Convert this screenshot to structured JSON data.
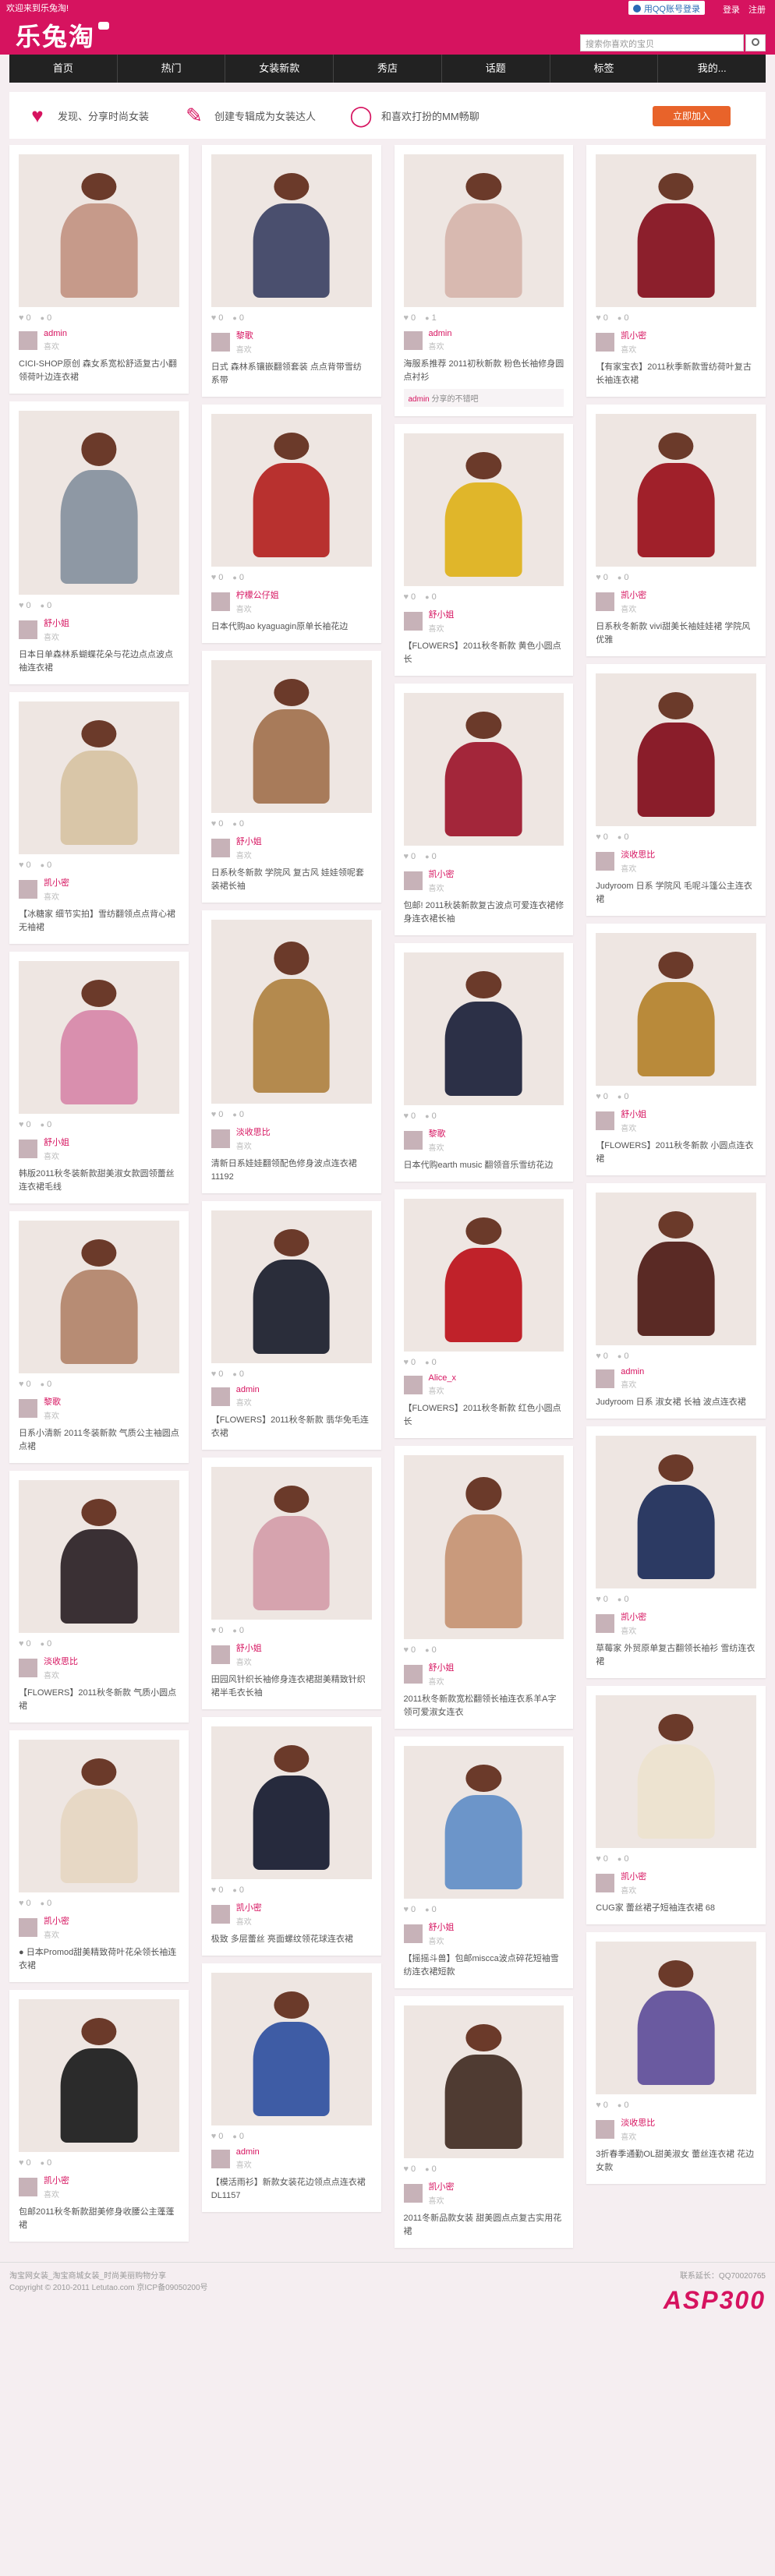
{
  "header": {
    "welcome": "欢迎来到乐兔淘!",
    "logo": "乐兔淘",
    "qq_login": "用QQ账号登录",
    "login": "登录",
    "register": "注册",
    "search_placeholder": "搜索你喜欢的宝贝"
  },
  "nav": [
    "首页",
    "热门",
    "女装新款",
    "秀店",
    "话题",
    "标签",
    "我的..."
  ],
  "promo": {
    "items": [
      {
        "icon": "heart-icon",
        "text": "发现、分享时尚女装"
      },
      {
        "icon": "pencil-icon",
        "text": "创建专辑成为女装达人"
      },
      {
        "icon": "chat-icon",
        "text": "和喜欢打扮的MM畅聊"
      }
    ],
    "join": "立即加入"
  },
  "columns": [
    [
      {
        "likes": "0",
        "comments": "0",
        "author": "admin",
        "sub": "喜欢",
        "desc": "CICI-SHOP原创 森女系宽松舒适复古小翻领荷叶边连衣裙",
        "color": "#c69a8a"
      },
      {
        "likes": "0",
        "comments": "0",
        "author": "舒小姐",
        "sub": "喜欢",
        "desc": "日本日单森林系蝴蝶花朵与花边点点波点袖连衣裙",
        "color": "#8e98a4"
      },
      {
        "likes": "0",
        "comments": "0",
        "author": "凯小密",
        "sub": "喜欢",
        "desc": "【冰糖家 细节实拍】雪纺翻领点点背心裙 无袖裙",
        "color": "#d9c6a8"
      },
      {
        "likes": "0",
        "comments": "0",
        "author": "舒小姐",
        "sub": "喜欢",
        "desc": "韩版2011秋冬装新款甜美淑女款圆领蕾丝连衣裙毛线",
        "color": "#d98fae"
      },
      {
        "likes": "0",
        "comments": "0",
        "author": "黎歌",
        "sub": "喜欢",
        "desc": "日系小清新 2011冬装新款 气质公主袖圆点点裙",
        "color": "#b78c74"
      },
      {
        "likes": "0",
        "comments": "0",
        "author": "淡收思比",
        "sub": "喜欢",
        "desc": "【FLOWERS】2011秋冬新款 气质小圆点裙",
        "color": "#3a3034"
      },
      {
        "likes": "0",
        "comments": "0",
        "author": "凯小密",
        "sub": "喜欢",
        "desc": "● 日本Promod甜美精致荷叶花朵领长袖连衣裙",
        "color": "#e7d8c5"
      },
      {
        "likes": "0",
        "comments": "0",
        "author": "凯小密",
        "sub": "喜欢",
        "desc": "包邮2011秋冬新款甜美修身收腰公主蓬蓬裙",
        "color": "#2b2b2b"
      }
    ],
    [
      {
        "likes": "0",
        "comments": "0",
        "author": "黎歌",
        "sub": "喜欢",
        "desc": "日式 森林系镶嵌翻领套装 点点背带雪纺 系带",
        "color": "#4a4f6e"
      },
      {
        "likes": "0",
        "comments": "0",
        "author": "柠檬公仔姐",
        "sub": "喜欢",
        "desc": "日本代购ao kyaguagin原单长袖花边",
        "color": "#b8312f"
      },
      {
        "likes": "0",
        "comments": "0",
        "author": "舒小姐",
        "sub": "喜欢",
        "desc": "日系秋冬新款 学院风 复古风 娃娃领呢套装裙长袖",
        "color": "#a87b5a"
      },
      {
        "likes": "0",
        "comments": "0",
        "author": "淡收思比",
        "sub": "喜欢",
        "desc": "清新日系娃娃翻领配色修身波点连衣裙11192",
        "color": "#b48a4e"
      },
      {
        "likes": "0",
        "comments": "0",
        "author": "admin",
        "sub": "喜欢",
        "desc": "【FLOWERS】2011秋冬新款 翡华免毛连衣裙",
        "color": "#2a2d3a"
      },
      {
        "likes": "0",
        "comments": "0",
        "author": "舒小姐",
        "sub": "喜欢",
        "desc": "田园风针织长袖修身连衣裙甜美精致针织裙半毛衣长袖",
        "color": "#d6a3ae"
      },
      {
        "likes": "0",
        "comments": "0",
        "author": "凯小密",
        "sub": "喜欢",
        "desc": "极致 多层蕾丝 亮面螺纹领花球连衣裙",
        "color": "#262a3d"
      },
      {
        "likes": "0",
        "comments": "0",
        "author": "admin",
        "sub": "喜欢",
        "desc": "【模活雨衫】新款女装花边领点点连衣裙DL1157",
        "color": "#3e5ca5"
      }
    ],
    [
      {
        "likes": "0",
        "comments": "1",
        "author": "admin",
        "sub": "喜欢",
        "desc": "海服系推荐 2011初秋新款 粉色长袖修身圆点衬衫",
        "comment_user": "admin",
        "comment": "分享的不错吧",
        "color": "#d8b9b0"
      },
      {
        "likes": "0",
        "comments": "0",
        "author": "舒小姐",
        "sub": "喜欢",
        "desc": "【FLOWERS】2011秋冬新款 黄色小圆点长",
        "color": "#e0b62a"
      },
      {
        "likes": "0",
        "comments": "0",
        "author": "凯小密",
        "sub": "喜欢",
        "desc": "包邮! 2011秋装新款复古波点可爱连衣裙修身连衣裙长袖",
        "color": "#a3263a"
      },
      {
        "likes": "0",
        "comments": "0",
        "author": "黎歌",
        "sub": "喜欢",
        "desc": "日本代购earth music 翻领音乐雪纺花边",
        "color": "#2c3047"
      },
      {
        "likes": "0",
        "comments": "0",
        "author": "Alice_x",
        "sub": "喜欢",
        "desc": "【FLOWERS】2011秋冬新款 红色小圆点长",
        "color": "#c0222a"
      },
      {
        "likes": "0",
        "comments": "0",
        "author": "舒小姐",
        "sub": "喜欢",
        "desc": "2011秋冬新款宽松翻领长袖连衣系羊A字领可爱淑女连衣",
        "color": "#c99a7c"
      },
      {
        "likes": "0",
        "comments": "0",
        "author": "舒小姐",
        "sub": "喜欢",
        "desc": "【摇摇斗兽】包邮miscca波点碎花短袖雪纺连衣裙短款",
        "color": "#6c95c9"
      },
      {
        "likes": "0",
        "comments": "0",
        "author": "凯小密",
        "sub": "喜欢",
        "desc": "2011冬新品款女装 甜美圆点点复古实用花裙",
        "color": "#4f3b32"
      }
    ],
    [
      {
        "likes": "0",
        "comments": "0",
        "author": "凯小密",
        "sub": "喜欢",
        "desc": "【有家宝衣】2011秋季新款雪纺荷叶复古长袖连衣裙",
        "color": "#8c1f2c"
      },
      {
        "likes": "0",
        "comments": "0",
        "author": "凯小密",
        "sub": "喜欢",
        "desc": "日系秋冬新款 vivi甜美长袖娃娃裙 学院风 优雅",
        "color": "#a0202a"
      },
      {
        "likes": "0",
        "comments": "0",
        "author": "淡收思比",
        "sub": "喜欢",
        "desc": "Judyroom 日系 学院风 毛呢斗篷公主连衣裙",
        "color": "#8a1d2a"
      },
      {
        "likes": "0",
        "comments": "0",
        "author": "舒小姐",
        "sub": "喜欢",
        "desc": "【FLOWERS】2011秋冬新款 小圆点连衣裙",
        "color": "#b98a3a"
      },
      {
        "likes": "0",
        "comments": "0",
        "author": "admin",
        "sub": "喜欢",
        "desc": "Judyroom 日系 淑女裙 长袖 波点连衣裙",
        "color": "#5a2a25"
      },
      {
        "likes": "0",
        "comments": "0",
        "author": "凯小密",
        "sub": "喜欢",
        "desc": "草莓家 外贸原单复古翻领长袖衫 雪纺连衣裙",
        "color": "#2c3a63"
      },
      {
        "likes": "0",
        "comments": "0",
        "author": "凯小密",
        "sub": "喜欢",
        "desc": "CUG家 蕾丝裙子短袖连衣裙 68",
        "color": "#ede3d0"
      },
      {
        "likes": "0",
        "comments": "0",
        "author": "淡收思比",
        "sub": "喜欢",
        "desc": "3折春季通勤OL甜美淑女 蕾丝连衣裙 花边女款",
        "color": "#6a5aa0"
      }
    ]
  ],
  "footer": {
    "line1": "淘宝网女装_淘宝商城女装_时尚美丽购物分享",
    "line2": "Copyright © 2010-2011 Letutao.com 京ICP备09050200号",
    "contact": "联系延长：QQ70020765",
    "brand": "ASP300"
  }
}
